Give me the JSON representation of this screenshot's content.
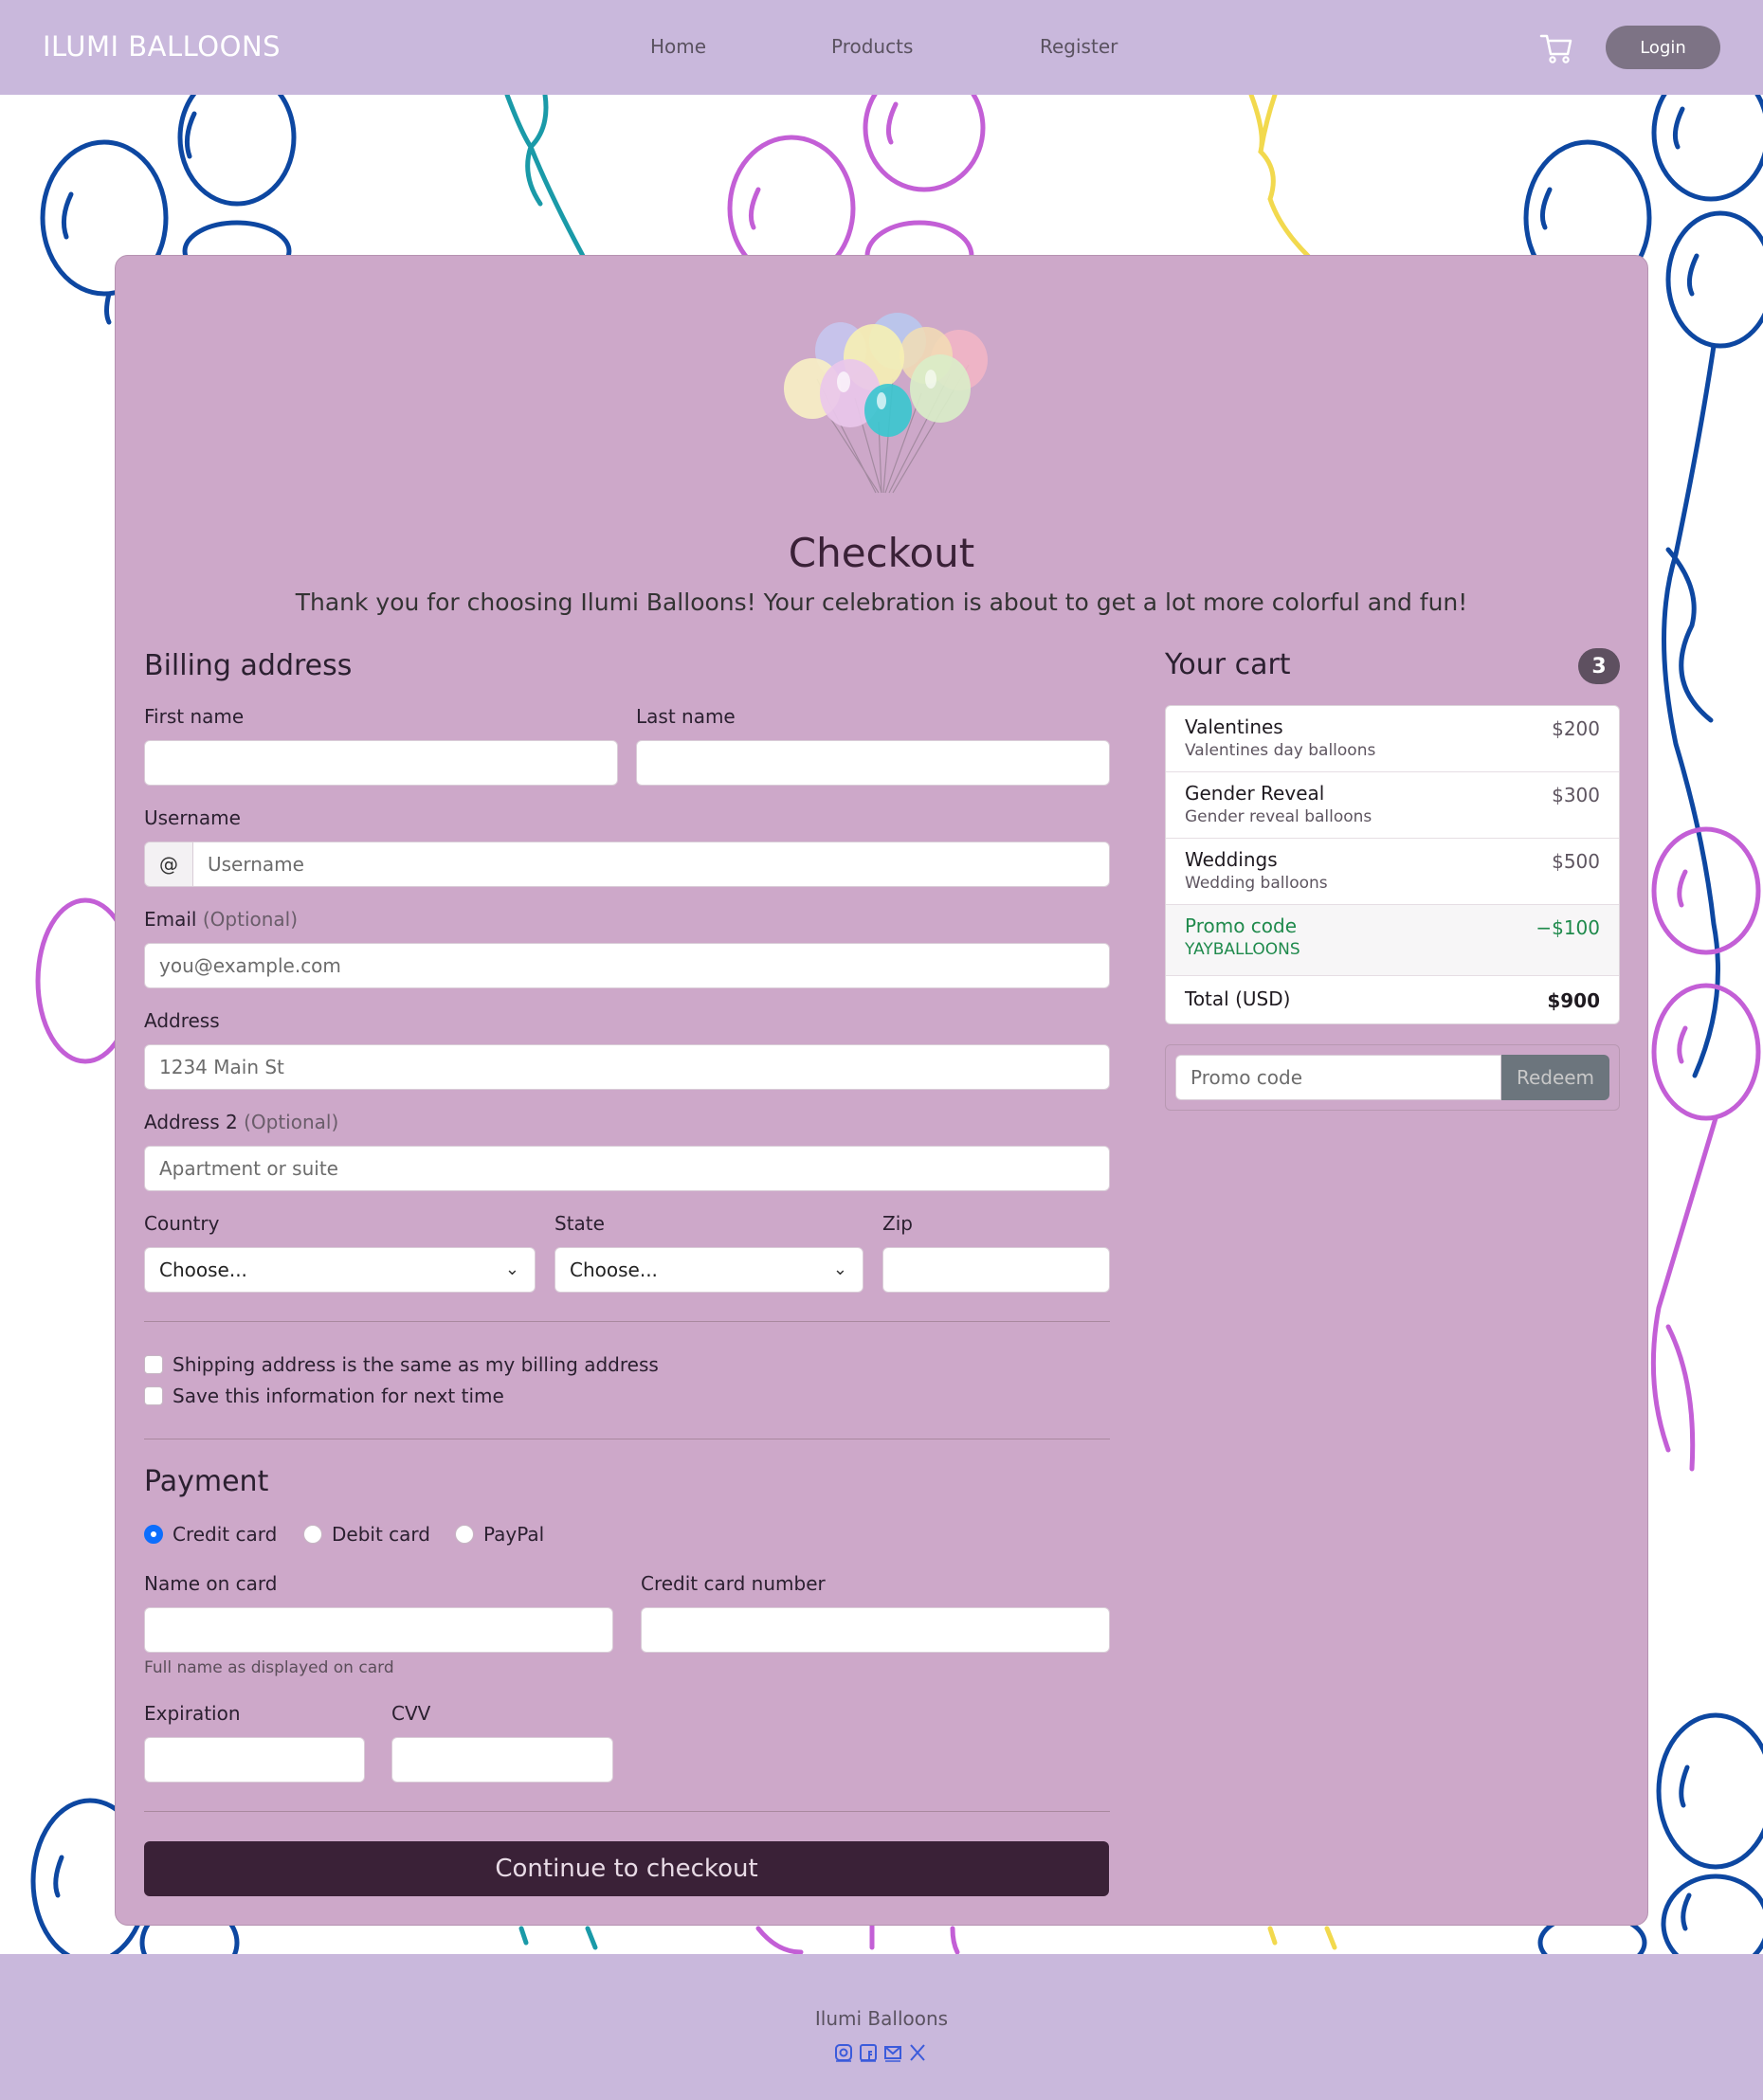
{
  "nav": {
    "brand": "ILUMI BALLOONS",
    "links": [
      "Home",
      "Products",
      "Register"
    ],
    "login_label": "Login"
  },
  "checkout": {
    "title": "Checkout",
    "subtitle": "Thank you for choosing Ilumi Balloons! Your celebration is about to get a lot more colorful and fun!"
  },
  "billing": {
    "heading": "Billing address",
    "first_name_label": "First name",
    "first_name_value": "",
    "last_name_label": "Last name",
    "last_name_value": "",
    "username_label": "Username",
    "username_prefix": "@",
    "username_placeholder": "Username",
    "email_label": "Email",
    "email_optional": "(Optional)",
    "email_placeholder": "you@example.com",
    "address_label": "Address",
    "address_placeholder": "1234 Main St",
    "address2_label": "Address 2",
    "address2_optional": "(Optional)",
    "address2_placeholder": "Apartment or suite",
    "country_label": "Country",
    "country_value": "Choose...",
    "state_label": "State",
    "state_value": "Choose...",
    "zip_label": "Zip",
    "zip_value": "",
    "same_address_label": "Shipping address is the same as my billing address",
    "save_info_label": "Save this information for next time"
  },
  "payment": {
    "heading": "Payment",
    "methods": [
      "Credit card",
      "Debit card",
      "PayPal"
    ],
    "selected_method": "Credit card",
    "name_on_card_label": "Name on card",
    "name_on_card_help": "Full name as displayed on card",
    "card_number_label": "Credit card number",
    "expiration_label": "Expiration",
    "cvv_label": "CVV",
    "submit_label": "Continue to checkout"
  },
  "cart": {
    "heading": "Your cart",
    "count": "3",
    "items": [
      {
        "name": "Valentines",
        "desc": "Valentines day balloons",
        "price": "$200"
      },
      {
        "name": "Gender Reveal",
        "desc": "Gender reveal balloons",
        "price": "$300"
      },
      {
        "name": "Weddings",
        "desc": "Wedding balloons",
        "price": "$500"
      }
    ],
    "promo": {
      "label": "Promo code",
      "code": "YAYBALLOONS",
      "amount": "−$100"
    },
    "total_label": "Total (USD)",
    "total_value": "$900",
    "promo_input_placeholder": "Promo code",
    "redeem_label": "Redeem"
  },
  "footer": {
    "name": "Ilumi Balloons",
    "social_icons": [
      "instagram-icon",
      "facebook-icon",
      "email-icon",
      "x-icon"
    ]
  },
  "colors": {
    "nav_bg": "#c9b8dc",
    "card_bg": "#cda8c9",
    "button_dark": "#3a2137",
    "promo_green": "#1f8a4c",
    "balloon_blue": "#0d47a1",
    "balloon_purple": "#c35fd6",
    "balloon_teal": "#1a9aa8",
    "balloon_yellow": "#f2d94e"
  }
}
